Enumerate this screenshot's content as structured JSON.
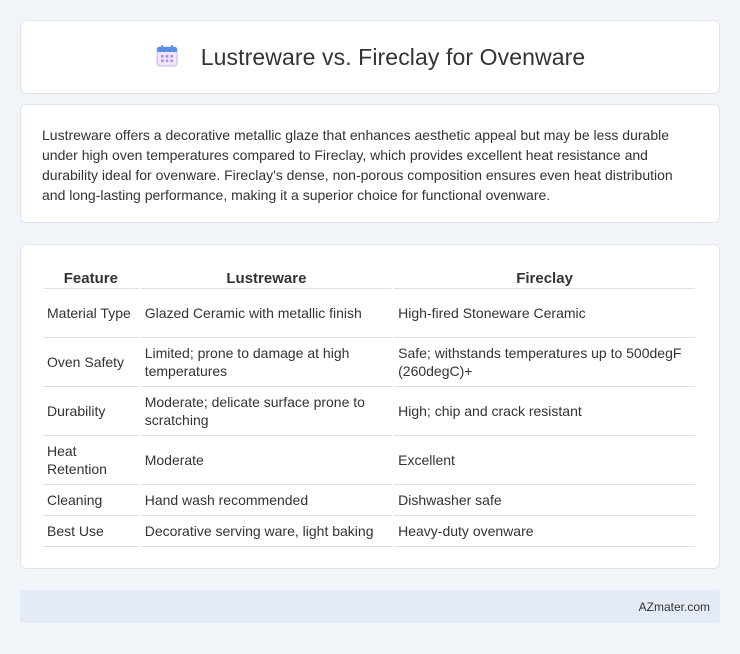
{
  "header": {
    "icon": "calendar-icon",
    "title": "Lustreware vs. Fireclay for Ovenware"
  },
  "description": "Lustreware offers a decorative metallic glaze that enhances aesthetic appeal but may be less durable under high oven temperatures compared to Fireclay, which provides excellent heat resistance and durability ideal for ovenware. Fireclay's dense, non-porous composition ensures even heat distribution and long-lasting performance, making it a superior choice for functional ovenware.",
  "table": {
    "headers": [
      "Feature",
      "Lustreware",
      "Fireclay"
    ],
    "rows": [
      [
        "Material Type",
        "Glazed Ceramic with metallic finish",
        "High-fired Stoneware Ceramic"
      ],
      [
        "Oven Safety",
        "Limited; prone to damage at high temperatures",
        "Safe; withstands temperatures up to 500degF (260degC)+"
      ],
      [
        "Durability",
        "Moderate; delicate surface prone to scratching",
        "High; chip and crack resistant"
      ],
      [
        "Heat Retention",
        "Moderate",
        "Excellent"
      ],
      [
        "Cleaning",
        "Hand wash recommended",
        "Dishwasher safe"
      ],
      [
        "Best Use",
        "Decorative serving ware, light baking",
        "Heavy-duty ovenware"
      ]
    ]
  },
  "footer": {
    "site": "AZmater.com"
  },
  "colors": {
    "background": "#f1f4f9",
    "footer_bg": "#e5ebf6",
    "icon_blue": "#5b8fe0",
    "icon_purple": "#b58be6"
  }
}
